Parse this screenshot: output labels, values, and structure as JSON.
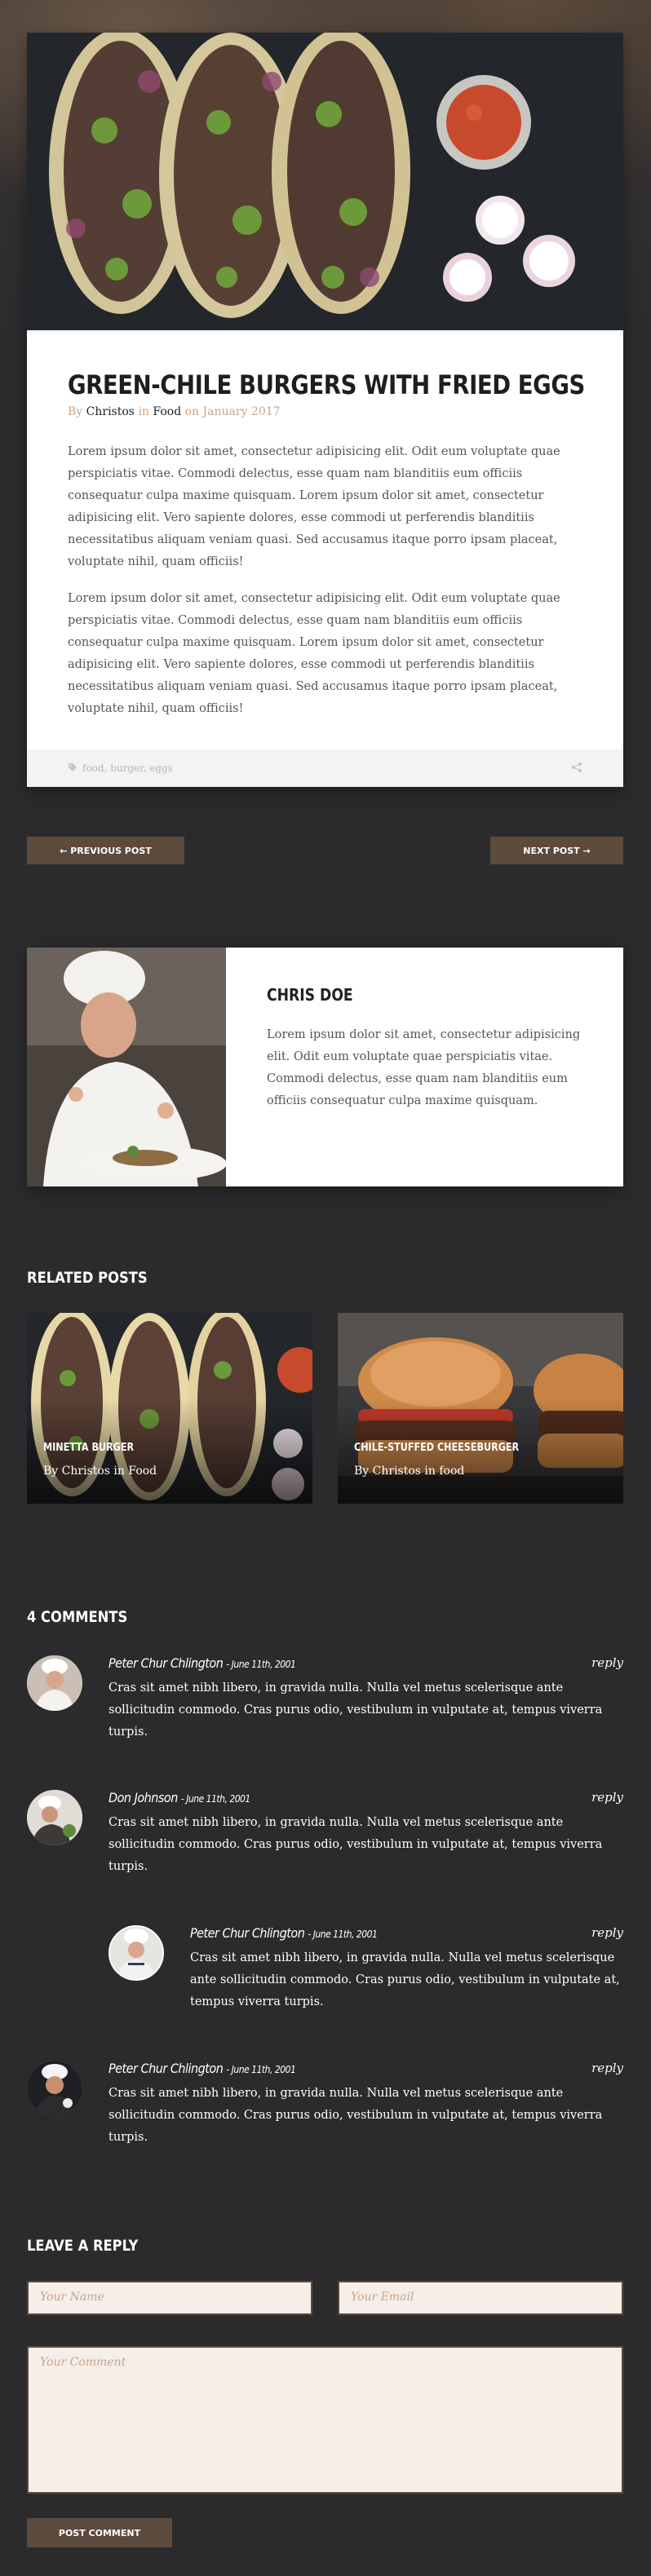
{
  "post": {
    "title": "GREEN-CHILE BURGERS WITH FRIED EGGS",
    "by": "By",
    "author": "Christos",
    "in": "in",
    "category": "Food",
    "date": "on January 2017",
    "paragraph1": "Lorem ipsum dolor sit amet, consectetur adipisicing elit. Odit eum voluptate quae perspiciatis vitae. Commodi delectus, esse quam nam blanditiis eum officiis consequatur culpa maxime quisquam. Lorem ipsum dolor sit amet, consectetur adipisicing elit. Vero sapiente dolores, esse commodi ut perferendis blanditiis necessitatibus aliquam veniam quasi. Sed accusamus itaque porro ipsam placeat, voluptate nihil, quam officiis!",
    "paragraph2": "Lorem ipsum dolor sit amet, consectetur adipisicing elit. Odit eum voluptate quae perspiciatis vitae. Commodi delectus, esse quam nam blanditiis eum officiis consequatur culpa maxime quisquam. Lorem ipsum dolor sit amet, consectetur adipisicing elit. Vero sapiente dolores, esse commodi ut perferendis blanditiis necessitatibus aliquam veniam quasi. Sed accusamus itaque porro ipsam placeat, voluptate nihil, quam officiis!",
    "tags": "food, burger, eggs",
    "tag_icon": "tag-icon",
    "share_icon": "share-icon"
  },
  "pager": {
    "prev": "← PREVIOUS POST",
    "next": "NEXT POST →"
  },
  "author_box": {
    "name": "CHRIS DOE",
    "bio": "Lorem ipsum dolor sit amet, consectetur adipisicing elit. Odit eum voluptate quae perspiciatis vitae. Commodi delectus, esse quam nam blanditiis eum officiis consequatur culpa maxime quisquam."
  },
  "related": {
    "heading": "RELATED POSTS",
    "items": [
      {
        "title": "MINETTA BURGER",
        "by": "By Christos in Food"
      },
      {
        "title": "CHILE-STUFFED CHEESEBURGER",
        "by": "By Christos in food"
      }
    ]
  },
  "comments": {
    "heading": "4 COMMENTS",
    "items": [
      {
        "name": "Peter Chur Chlington",
        "date": "- June 11th, 2001",
        "reply": "reply",
        "text": "Cras sit amet nibh libero, in gravida nulla. Nulla vel metus scelerisque ante sollicitudin commodo. Cras purus odio, vestibulum in vulputate at, tempus viverra turpis."
      },
      {
        "name": "Don Johnson",
        "date": "- June 11th, 2001",
        "reply": "reply",
        "text": "Cras sit amet nibh libero, in gravida nulla. Nulla vel metus scelerisque ante sollicitudin commodo. Cras purus odio, vestibulum in vulputate at, tempus viverra turpis."
      },
      {
        "name": "Peter Chur Chlington",
        "date": "- June 11th, 2001",
        "reply": "reply",
        "text": "Cras sit amet nibh libero, in gravida nulla. Nulla vel metus scelerisque ante sollicitudin commodo. Cras purus odio, vestibulum in vulputate at, tempus viverra turpis."
      },
      {
        "name": "Peter Chur Chlington",
        "date": "- June 11th, 2001",
        "reply": "reply",
        "text": "Cras sit amet nibh libero, in gravida nulla. Nulla vel metus scelerisque ante sollicitudin commodo. Cras purus odio, vestibulum in vulputate at, tempus viverra turpis."
      }
    ]
  },
  "reply_form": {
    "heading": "LEAVE A REPLY",
    "name_placeholder": "Your Name",
    "email_placeholder": "Your Email",
    "comment_placeholder": "Your Comment",
    "submit": "POST COMMENT"
  },
  "colors": {
    "background": "#2b2b2e",
    "accent_brown": "#5c4a3c",
    "meta_tan": "#c9a488",
    "field_bg": "#f5eee9"
  }
}
